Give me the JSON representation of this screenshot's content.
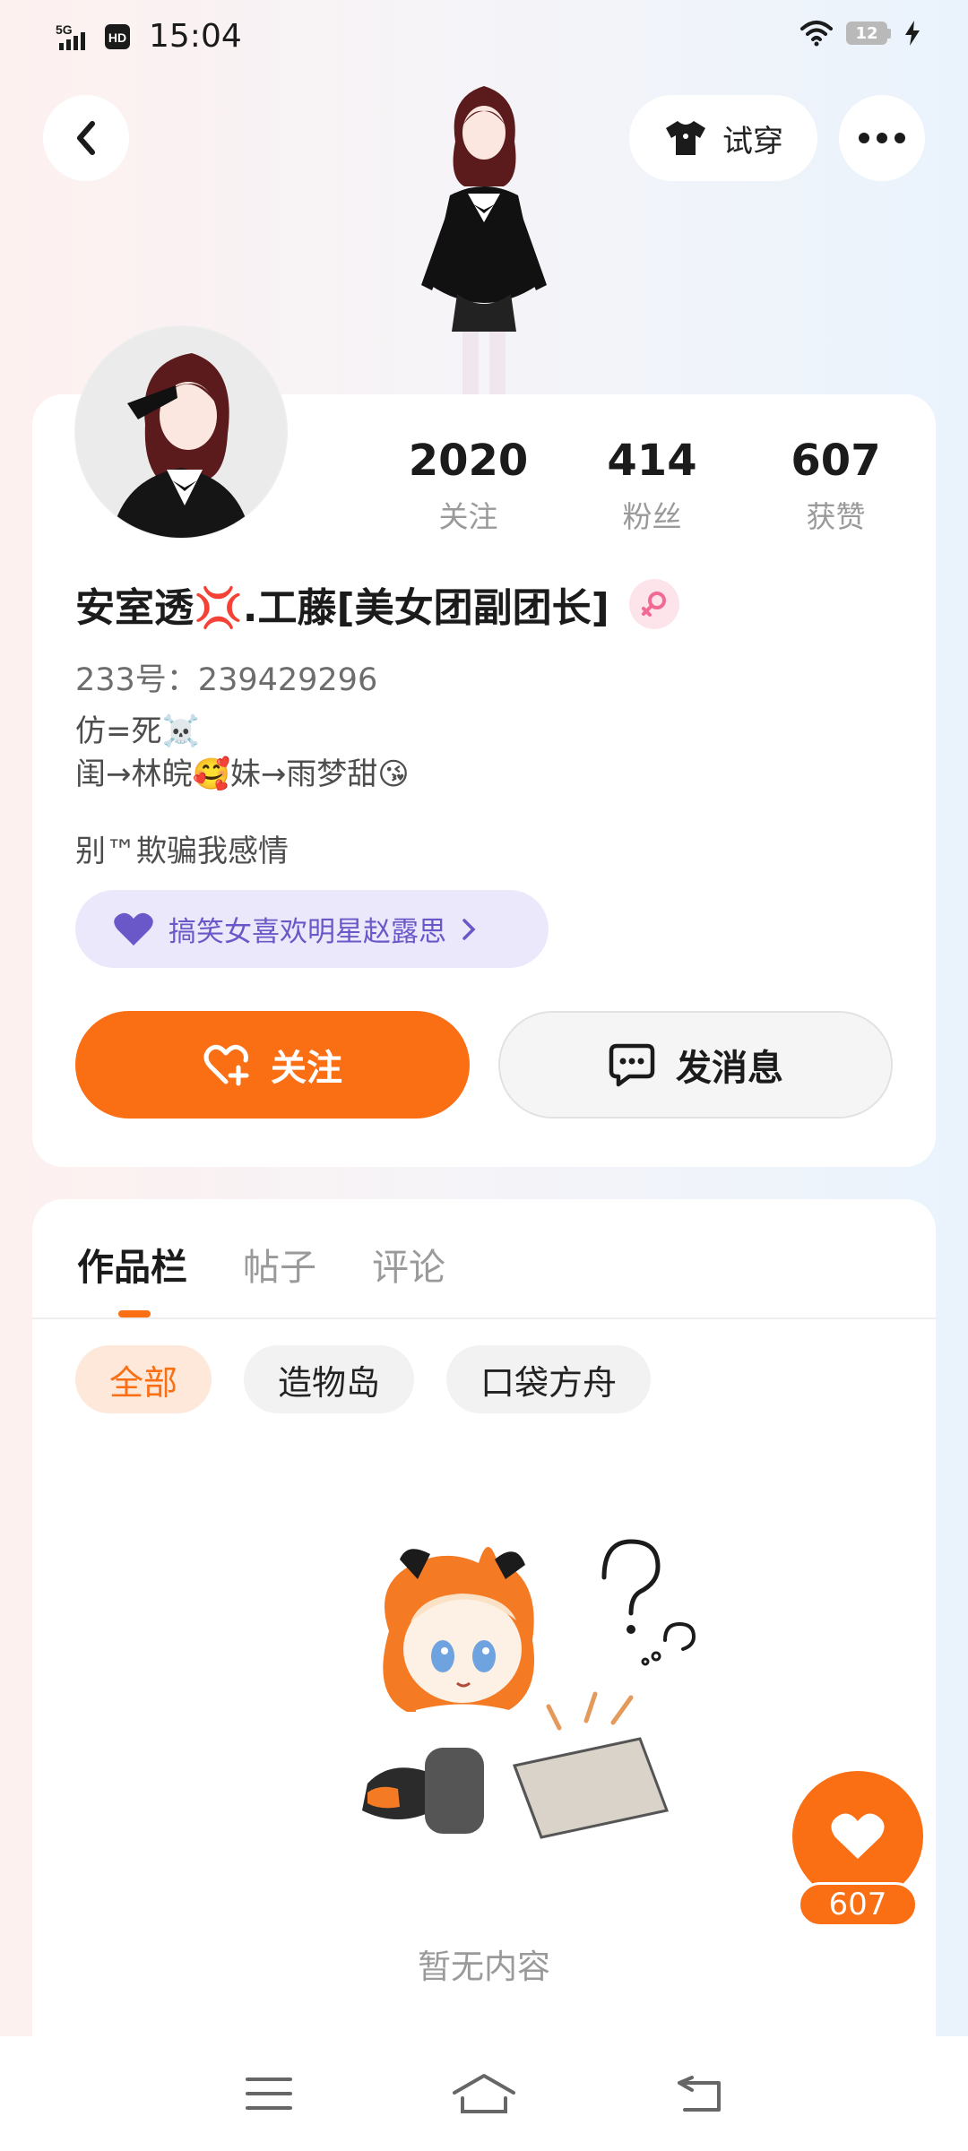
{
  "status_bar": {
    "network": "5G",
    "hd": "HD",
    "time": "15:04",
    "battery": "12"
  },
  "header": {
    "try_on_label": "试穿"
  },
  "profile": {
    "stats": [
      {
        "value": "2020",
        "label": "关注"
      },
      {
        "value": "414",
        "label": "粉丝"
      },
      {
        "value": "607",
        "label": "获赞"
      }
    ],
    "nickname": "安室透💢.工藤[美女团副团长]",
    "uid": "233号：239429296",
    "bio_line1": "仿=死☠️",
    "bio_line2": "闺→林皖🥰妹→雨梦甜😘",
    "signature": "别™欺骗我感情",
    "fan_tag": "搞笑女喜欢明星赵露思",
    "follow_label": "关注",
    "message_label": "发消息"
  },
  "content": {
    "tabs": [
      "作品栏",
      "帖子",
      "评论"
    ],
    "filters": [
      "全部",
      "造物岛",
      "口袋方舟"
    ],
    "empty_text": "暂无内容"
  },
  "like_fab": {
    "count": "607"
  },
  "colors": {
    "accent": "#fa6e14",
    "tag_purple": "#6b58c8"
  },
  "icons": [
    "back-arrow-icon",
    "tshirt-icon",
    "more-dots-icon",
    "female-icon",
    "heart-icon",
    "chevron-right-icon",
    "follow-heart-plus-icon",
    "chat-bubble-icon",
    "menu-icon",
    "home-icon",
    "back-icon"
  ]
}
